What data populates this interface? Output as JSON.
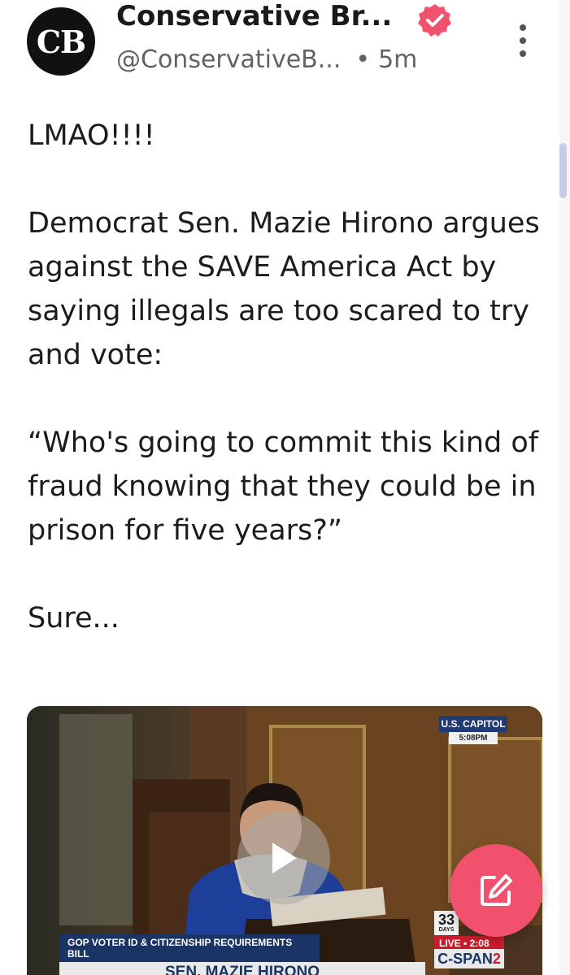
{
  "post": {
    "author": {
      "avatar_text": "CB",
      "name": "Conservative Br...",
      "handle": "@ConservativeB...",
      "separator": "•",
      "time": "5m",
      "verified_icon": "verified-badge-icon",
      "verified_color": "#f2516e"
    },
    "more_icon": "more-vertical-icon",
    "text": {
      "line_1": "LMAO!!!!",
      "paragraph_2": "Democrat Sen. Mazie Hirono argues against the SAVE America Act by saying illegals are too scared to try and vote:",
      "paragraph_3": "“Who's going to commit this kind of fraud knowing that they could be in prison for five years?”",
      "line_4": "Sure..."
    },
    "video": {
      "play_icon": "play-icon",
      "overlay": {
        "location": "U.S. CAPITOL",
        "location_time": "5:08PM",
        "bill_caption": "GOP VOTER ID & CITIZENSHIP REQUIREMENTS BILL",
        "speaker": "SEN. MAZIE HIRONO",
        "days_count": "33",
        "days_label": "DAYS",
        "live_label": "LIVE",
        "live_time": "2:08",
        "network": "C-SPAN",
        "network_suffix": "2"
      }
    }
  },
  "compose_button": {
    "icon": "compose-icon",
    "color": "#f2516e"
  },
  "colors": {
    "accent": "#f2516e",
    "text": "#1c1c1c",
    "muted": "#5f6368",
    "scroll_thumb": "#c9cbe6"
  }
}
